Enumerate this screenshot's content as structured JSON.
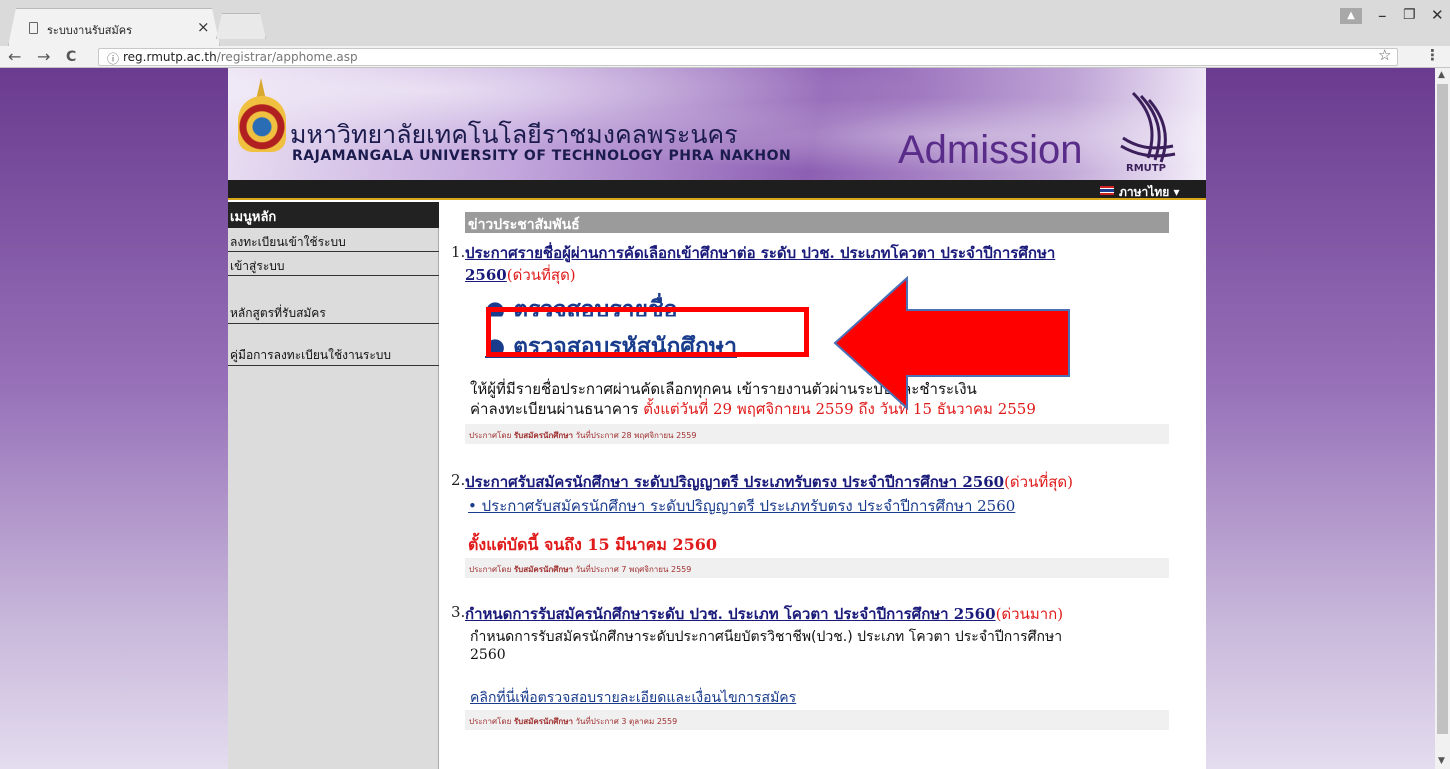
{
  "browser": {
    "tab_title": "ระบบงานรับสมัคร",
    "tab_close": "×",
    "back": "←",
    "forward": "→",
    "reload": "C",
    "info": "ⓘ",
    "url_host": "reg.rmutp.ac.th",
    "url_path": "/registrar/apphome.asp",
    "star": "☆",
    "menu": "⋮",
    "minimize": "–",
    "restore": "❐",
    "close": "✕"
  },
  "banner": {
    "name_th": "มหาวิทยาลัยเทคโนโลยีราชมงคลพระนคร",
    "name_en": "RAJAMANGALA UNIVERSITY OF TECHNOLOGY PHRA NAKHON",
    "admission": "Admission",
    "logo_text": "RMUTP",
    "language": "ภาษาไทย ▾"
  },
  "sidebar": {
    "header": "เมนูหลัก",
    "items": [
      {
        "label": "ลงทะเบียนเข้าใช้ระบบ"
      },
      {
        "label": "เข้าสู่ระบบ"
      },
      {
        "label": "หลักสูตรที่รับสมัคร"
      },
      {
        "label": "คู่มือการลงทะเบียนใช้งานระบบ"
      }
    ]
  },
  "news": {
    "header": "ข่าวประชาสัมพันธ์",
    "items": [
      {
        "number": "1.",
        "title_line1": "ประกาศรายชื่อผู้ผ่านการคัดเลือกเข้าศึกษาต่อ ระดับ ปวช. ประเภทโควตา ประจำปีการศึกษา",
        "title_line2": "2560",
        "urgency": "(ด่วนที่สุด)",
        "link1": "● ตรวจสอบรายชื่อ",
        "link2": "● ตรวจสอบรหัสนักศึกษา",
        "body_line1": "ให้ผู้ที่มีรายชื่อประกาศผ่านคัดเลือกทุกคน เข้ารายงานตัวผ่านระบบและชำระเงิน",
        "body_line2_prefix": "ค่าลงทะเบียนผ่านธนาคาร",
        "body_line2_dates": " ตั้งแต่วันที่ 29 พฤศจิกายน 2559 ถึง วันที่ 15 ธันวาคม 2559",
        "meta_by_label": "ประกาศโดย",
        "meta_by": "รับสมัครนักศึกษา",
        "meta_date_label": "วันที่ประกาศ",
        "meta_date": "28 พฤศจิกายน 2559"
      },
      {
        "number": "2.",
        "title": "ประกาศรับสมัครนักศึกษา ระดับปริญญาตรี ประเภทรับตรง ประจำปีการศึกษา 2560",
        "urgency": "(ด่วนที่สุด)",
        "sublink": "• ประกาศรับสมัครนักศึกษา ระดับปริญญาตรี ประเภทรับตรง ประจำปีการศึกษา 2560",
        "period": "ตั้งแต่บัดนี้ จนถึง 15 มีนาคม 2560",
        "meta_by_label": "ประกาศโดย",
        "meta_by": "รับสมัครนักศึกษา",
        "meta_date_label": "วันที่ประกาศ",
        "meta_date": "7 พฤศจิกายน 2559"
      },
      {
        "number": "3.",
        "title": "กำหนดการรับสมัครนักศึกษาระดับ ปวช. ประเภท โควตา ประจำปีการศึกษา 2560",
        "urgency": "(ด่วนมาก)",
        "body_line1": "กำหนดการรับสมัครนักศึกษาระดับประกาศนียบัตรวิชาชีพ(ปวช.) ประเภท โควตา ประจำปีการศึกษา",
        "body_line2": "2560",
        "detail_link": "คลิกที่นี่เพื่อตรวจสอบรายละเอียดและเงื่อนไขการสมัคร",
        "meta_by_label": "ประกาศโดย",
        "meta_by": "รับสมัครนักศึกษา",
        "meta_date_label": "วันที่ประกาศ",
        "meta_date": "3 ตุลาคม 2559"
      }
    ]
  },
  "colors": {
    "annotation_red": "#ff0000",
    "link_blue": "#1a1a7a",
    "urgent_red": "#e01a1a"
  }
}
